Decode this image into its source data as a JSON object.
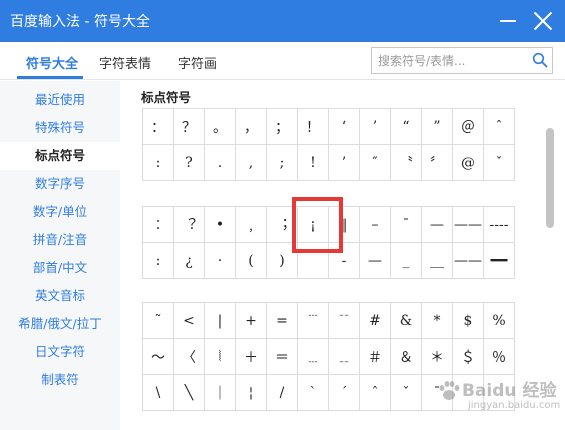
{
  "window": {
    "title": "百度输入法 - 符号大全"
  },
  "tabs": [
    {
      "label": "符号大全",
      "active": true
    },
    {
      "label": "字符表情",
      "active": false
    },
    {
      "label": "字符画",
      "active": false
    }
  ],
  "search": {
    "placeholder": "搜索符号/表情..."
  },
  "sidebar": {
    "items": [
      {
        "label": "最近使用",
        "active": false
      },
      {
        "label": "特殊符号",
        "active": false
      },
      {
        "label": "标点符号",
        "active": true
      },
      {
        "label": "数字序号",
        "active": false
      },
      {
        "label": "数字/单位",
        "active": false
      },
      {
        "label": "拼音/注音",
        "active": false
      },
      {
        "label": "部首/中文",
        "active": false
      },
      {
        "label": "英文音标",
        "active": false
      },
      {
        "label": "希腊/俄文/拉丁",
        "active": false
      },
      {
        "label": "日文字符",
        "active": false
      },
      {
        "label": "制表符",
        "active": false
      }
    ]
  },
  "section": {
    "title": "标点符号"
  },
  "grid1": [
    [
      "：",
      "？",
      "。",
      "，",
      "；",
      "！",
      "‘",
      "’",
      "“",
      "”",
      "＠",
      "ˆ"
    ],
    [
      ":",
      "?",
      ".",
      ",",
      ";",
      "!",
      "’",
      "″",
      "〝",
      "〞",
      "@",
      "ˇ"
    ]
  ],
  "grid2": [
    [
      "︰",
      "︖",
      "•",
      "﹐",
      "︔",
      "¡",
      "‖",
      "–",
      "¯",
      "—",
      "——",
      "----"
    ],
    [
      ":",
      "¿",
      "·",
      "(",
      ")",
      "",
      "-",
      "—",
      "_",
      "＿",
      "——",
      "━━"
    ]
  ],
  "grid3": [
    [
      "˜",
      "<",
      "|",
      "+",
      "=",
      "﹉",
      "﹊",
      "#",
      "&",
      "*",
      "$",
      "%"
    ],
    [
      "～",
      "〈",
      "⦚",
      "＋",
      "＝",
      "﹍",
      "﹎",
      "＃",
      "＆",
      "＊",
      "＄",
      "％"
    ],
    [
      "\\",
      "╲",
      "｜",
      "¦",
      "/",
      "ˋ",
      "ˊ",
      "ˆ",
      "ˇ",
      "ˉ",
      "",
      ""
    ]
  ],
  "watermark": {
    "text": "Baidu 经验",
    "sub": "jingyan.baidu.com"
  },
  "colors": {
    "accent": "#2f7de1",
    "highlight": "#e53935"
  }
}
